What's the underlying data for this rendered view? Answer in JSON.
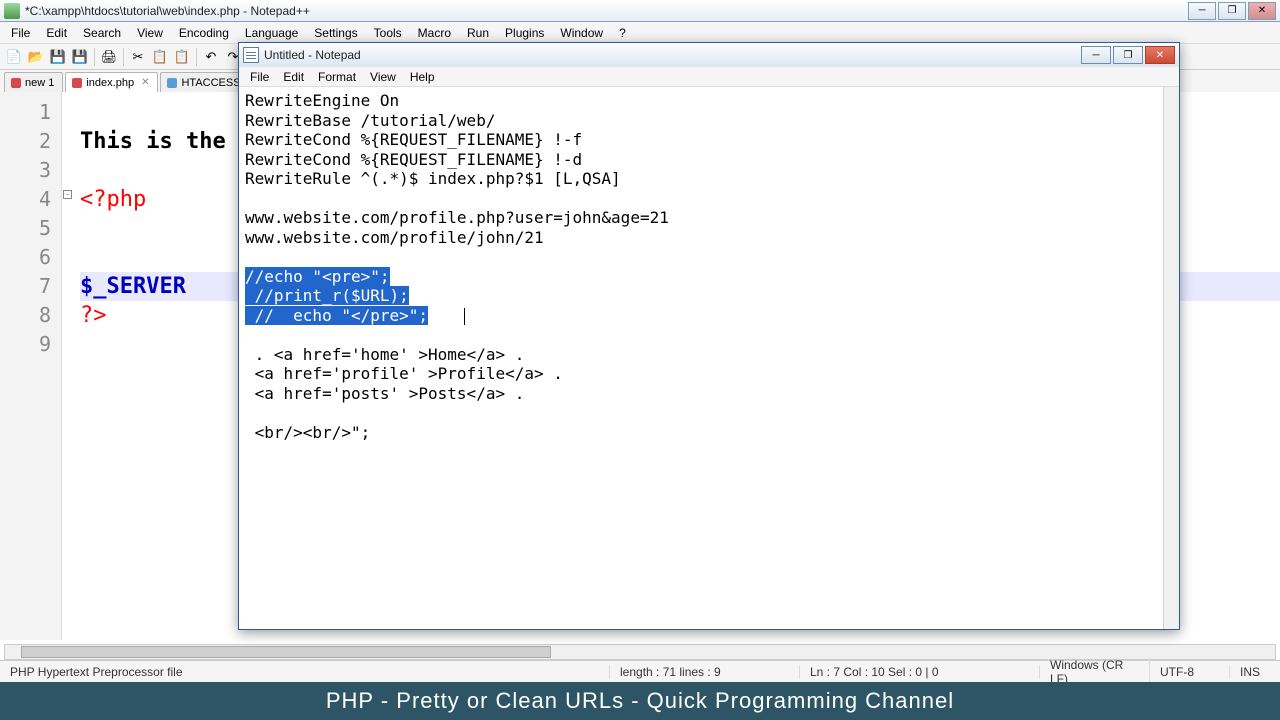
{
  "npp": {
    "title": "*C:\\xampp\\htdocs\\tutorial\\web\\index.php - Notepad++",
    "menu": [
      "File",
      "Edit",
      "Search",
      "View",
      "Encoding",
      "Language",
      "Settings",
      "Tools",
      "Macro",
      "Run",
      "Plugins",
      "Window",
      "?"
    ],
    "tabs": [
      {
        "label": "new 1",
        "dirty": true
      },
      {
        "label": "index.php",
        "dirty": true,
        "active": true
      },
      {
        "label": "HTACCESS",
        "dirty": false
      }
    ],
    "gutter": [
      "1",
      "2",
      "3",
      "4",
      "5",
      "6",
      "7",
      "8",
      "9"
    ],
    "code": {
      "l2": "This is the in",
      "l4": "<?php",
      "l7": "$_SERVER",
      "l8": "?>"
    },
    "status": {
      "lang": "PHP Hypertext Preprocessor file",
      "length": "length : 71    lines : 9",
      "pos": "Ln : 7    Col : 10    Sel : 0 | 0",
      "eol": "Windows (CR LF)",
      "enc": "UTF-8",
      "ins": "INS"
    }
  },
  "np": {
    "title": "Untitled - Notepad",
    "menu": [
      "File",
      "Edit",
      "Format",
      "View",
      "Help"
    ],
    "lines_top": [
      "RewriteEngine On",
      "RewriteBase /tutorial/web/",
      "RewriteCond %{REQUEST_FILENAME} !-f",
      "RewriteCond %{REQUEST_FILENAME} !-d",
      "RewriteRule ^(.*)$ index.php?$1 [L,QSA]",
      "",
      "www.website.com/profile.php?user=john&age=21",
      "www.website.com/profile/john/21",
      ""
    ],
    "selected": [
      "//echo \"<pre>\";",
      " //print_r($URL);",
      " //  echo \"</pre>\";"
    ],
    "lines_bottom": [
      "",
      " . <a href='home' >Home</a> . ",
      " <a href='profile' >Profile</a> . ",
      " <a href='posts' >Posts</a> . ",
      "",
      " <br/><br/>\";"
    ]
  },
  "caption": "PHP - Pretty or Clean URLs - Quick Programming Channel"
}
